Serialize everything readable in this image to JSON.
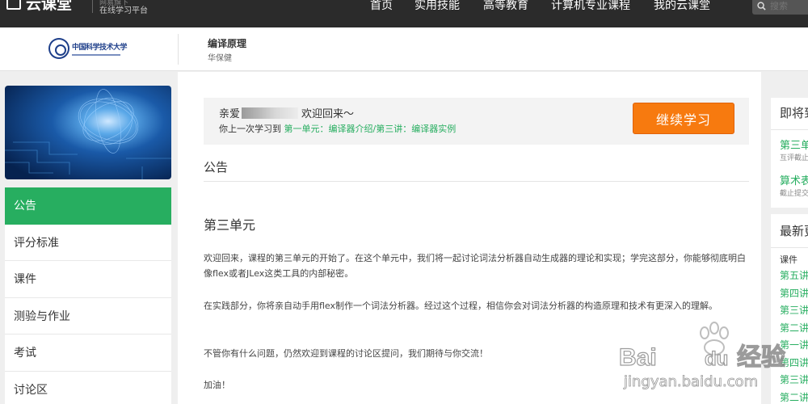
{
  "topnav": {
    "logo_text": "云课堂",
    "logo_sub1": "网易旗下",
    "logo_sub2": "在线学习平台",
    "items": [
      {
        "label": "首页"
      },
      {
        "label": "实用技能"
      },
      {
        "label": "高等教育"
      },
      {
        "label": "计算机专业课程"
      },
      {
        "label": "我的云课堂"
      }
    ],
    "search_placeholder": "搜索"
  },
  "course": {
    "university_name": "中国科学技术大学",
    "title": "编译原理",
    "teacher": "华保健"
  },
  "sidebar": {
    "items": [
      {
        "label": "公告",
        "active": true
      },
      {
        "label": "评分标准",
        "active": false
      },
      {
        "label": "课件",
        "active": false
      },
      {
        "label": "测验与作业",
        "active": false
      },
      {
        "label": "考试",
        "active": false
      },
      {
        "label": "讨论区",
        "active": false
      }
    ]
  },
  "welcome": {
    "greeting_prefix": "亲爱",
    "greeting_suffix": "欢迎回来～",
    "last_study_prefix": "你上一次学习到",
    "last_study_link": "第一单元：编译器介绍/第三讲：编译器实例",
    "continue_button": "继续学习"
  },
  "notice": {
    "title": "公告",
    "section_title": "第三单元",
    "paragraphs": [
      "欢迎回来，课程的第三单元的开始了。在这个单元中，我们将一起讨论词法分析器自动生成器的理论和实现；学完这部分，你能够彻底明白像flex或者JLex这类工具的内部秘密。",
      "在实践部分，你将亲自动手用flex制作一个词法分析器。经过这个过程，相信你会对词法分析器的构造原理和技术有更深入的理解。",
      "不管你有什么问题，仍然欢迎到课程的讨论区提问，我们期待与你交流！",
      "加油！"
    ]
  },
  "right": {
    "upcoming_title": "即将到",
    "upcoming": [
      {
        "title": "第三单",
        "sub": "互评截止"
      },
      {
        "title": "算术表",
        "sub": "截止提交"
      }
    ],
    "latest_title": "最新更",
    "latest_category": "课件",
    "latest_items": [
      "第五讲",
      "第四讲",
      "第三讲",
      "第二讲",
      "第一讲",
      "第四讲",
      "第三讲",
      "第二讲"
    ]
  },
  "watermark": {
    "brand": "Bai",
    "brand_du": "du",
    "brand_cn": "经验",
    "url": "jingyan.baidu.com"
  },
  "colors": {
    "accent_green": "#27ae60",
    "button_orange": "#f77a0f",
    "nav_bg": "#2b2b2b"
  }
}
